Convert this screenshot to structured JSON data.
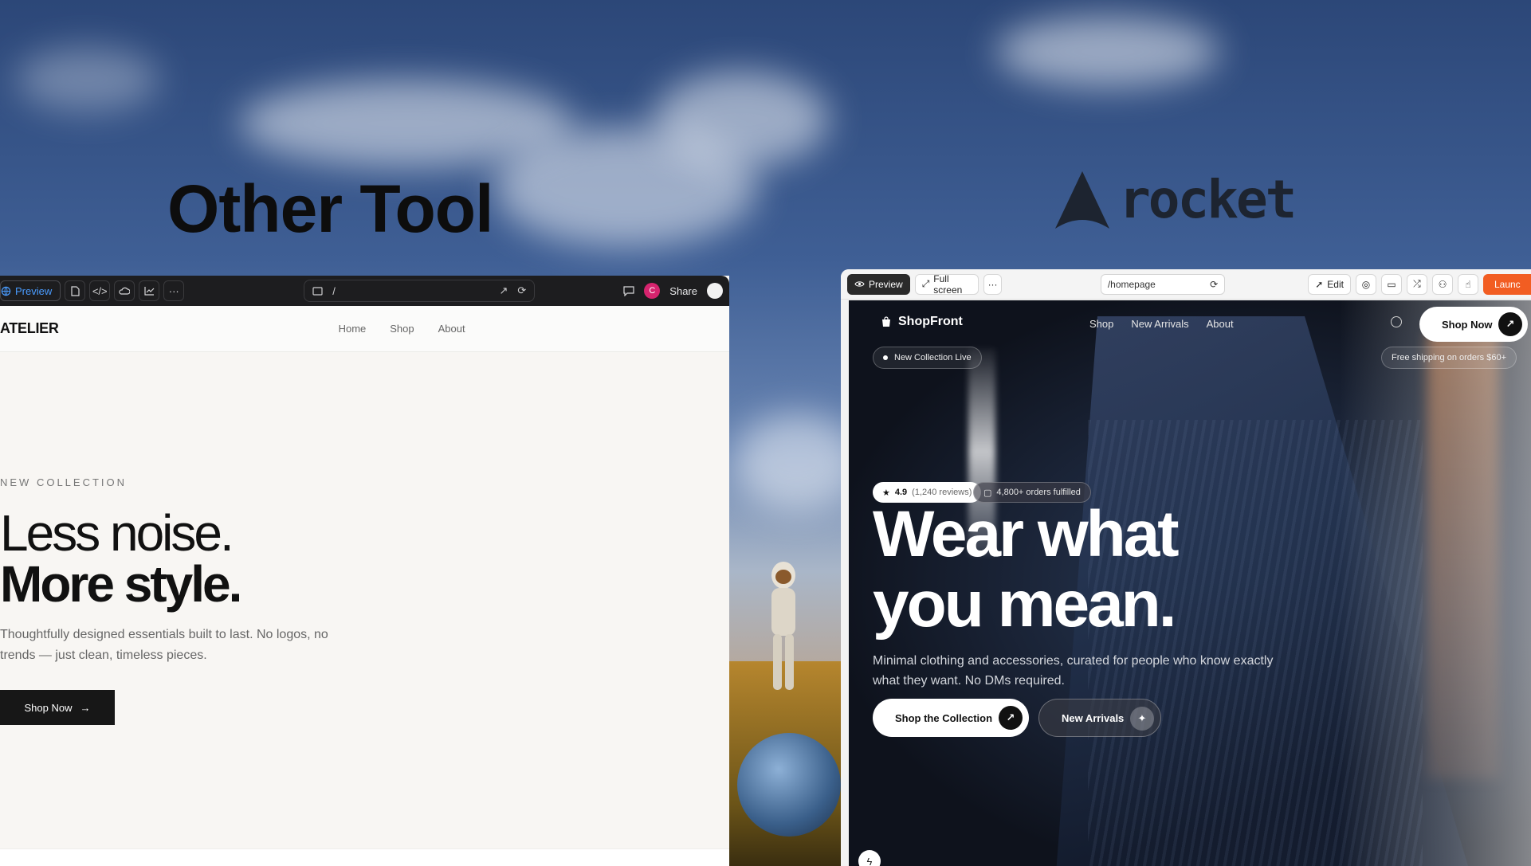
{
  "labels": {
    "left_title": "Other Tool",
    "right_brand": "rocket"
  },
  "left_window": {
    "toolbar": {
      "preview": "Preview",
      "url": "/",
      "share": "Share",
      "avatar_letter": "C"
    },
    "site": {
      "brand": "ATELIER",
      "nav": [
        "Home",
        "Shop",
        "About"
      ],
      "eyebrow": "NEW COLLECTION",
      "headline_light": "Less noise.",
      "headline_bold": "More style.",
      "description": "Thoughtfully designed essentials built to last. No logos, no trends — just clean, timeless pieces.",
      "cta": "Shop Now"
    }
  },
  "right_window": {
    "toolbar": {
      "preview": "Preview",
      "full_screen": "Full screen",
      "url": "/homepage",
      "edit": "Edit",
      "launch": "Launc"
    },
    "site": {
      "brand": "ShopFront",
      "nav": [
        "Shop",
        "New Arrivals",
        "About"
      ],
      "shop_now": "Shop Now",
      "collection_tag": "New Collection Live",
      "shipping_tag": "Free shipping on orders $60+",
      "rating": "4.9",
      "reviews": "(1,240 reviews)",
      "orders": "4,800+ orders fulfilled",
      "headline_line1": "Wear what",
      "headline_line2": "you mean.",
      "description": "Minimal clothing and accessories, curated for people who know exactly what they want. No DMs required.",
      "cta_primary": "Shop the Collection",
      "cta_secondary": "New Arrivals"
    }
  },
  "colors": {
    "accent_blue": "#4a9cff",
    "launch_orange": "#f25d22",
    "avatar_pink": "#d6246e"
  }
}
